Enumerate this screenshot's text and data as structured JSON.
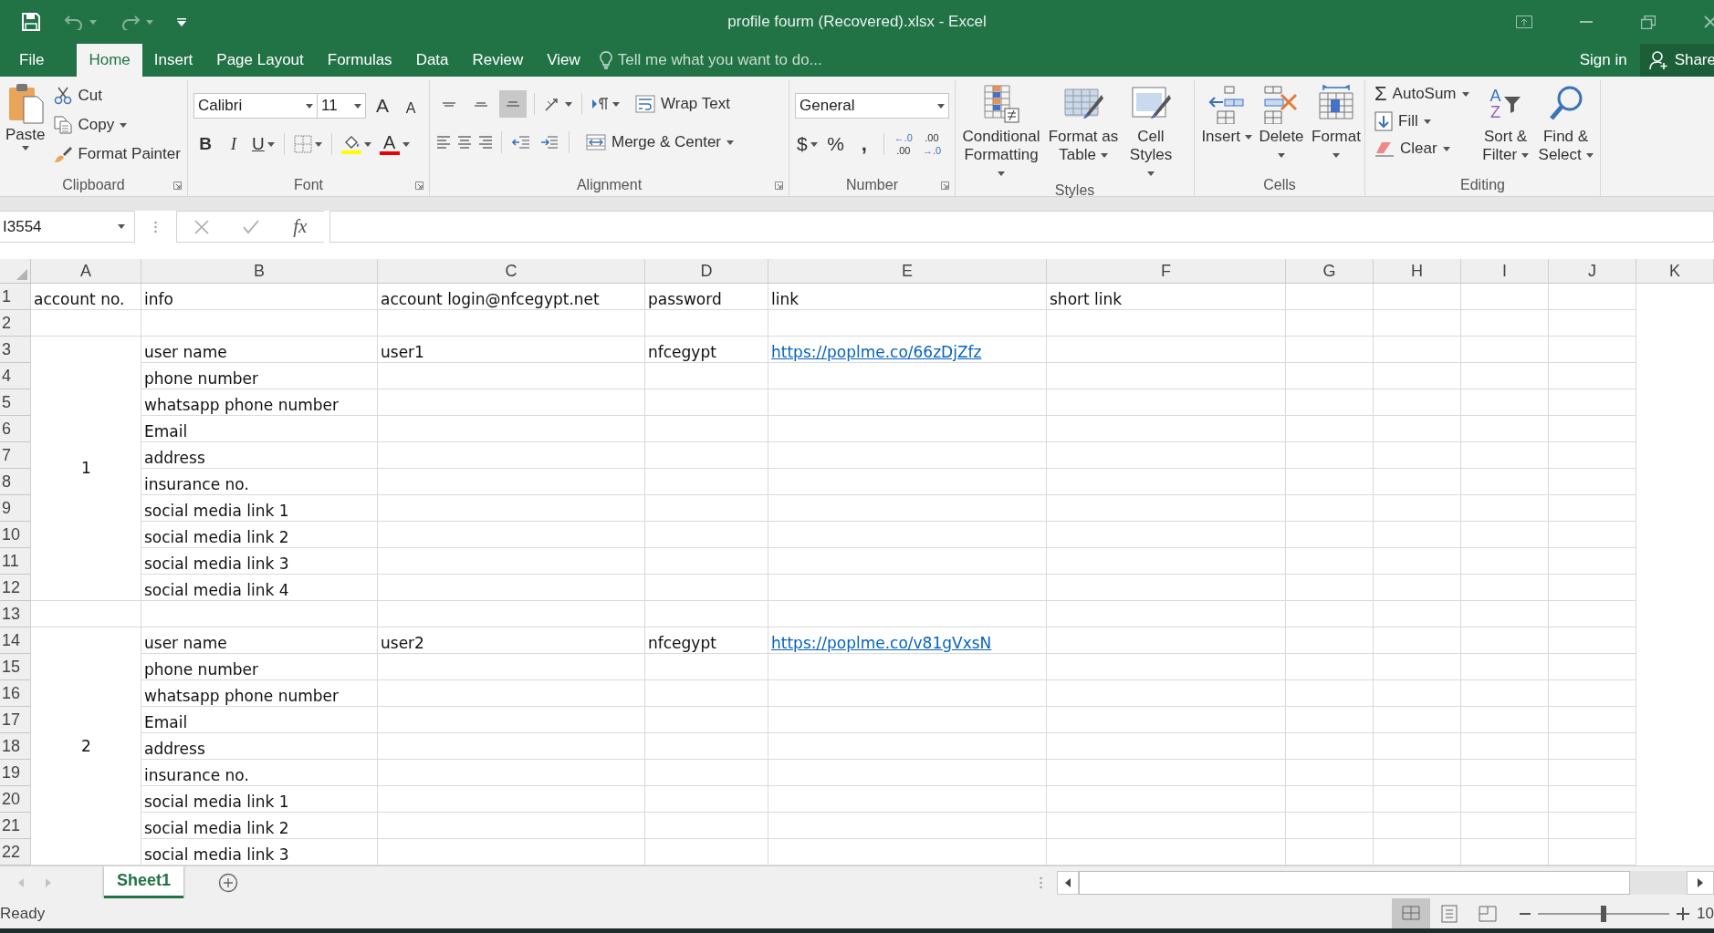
{
  "window": {
    "title": "profile fourm (Recovered).xlsx - Excel",
    "quick_access": [
      {
        "kind": "save",
        "disabled": false
      },
      {
        "kind": "undo",
        "disabled": true
      },
      {
        "kind": "redo",
        "disabled": true
      },
      {
        "kind": "customize",
        "disabled": false
      }
    ]
  },
  "tabs": [
    {
      "label": "File",
      "selected": false
    },
    {
      "label": "Home",
      "selected": true
    },
    {
      "label": "Insert",
      "selected": false
    },
    {
      "label": "Page Layout",
      "selected": false
    },
    {
      "label": "Formulas",
      "selected": false
    },
    {
      "label": "Data",
      "selected": false
    },
    {
      "label": "Review",
      "selected": false
    },
    {
      "label": "View",
      "selected": false
    }
  ],
  "tell_me": {
    "placeholder": "Tell me what you want to do..."
  },
  "account": {
    "sign_in": "Sign in",
    "share": "Share"
  },
  "ribbon": {
    "clipboard": {
      "label": "Clipboard",
      "paste": "Paste",
      "cut": "Cut",
      "copy": "Copy",
      "format_painter": "Format Painter"
    },
    "font": {
      "label": "Font",
      "font_name": "Calibri",
      "font_size": "11",
      "grow_font": "A",
      "shrink_font": "A",
      "bold": "B",
      "italic": "I",
      "underline": "U",
      "font_color": "A"
    },
    "alignment": {
      "label": "Alignment",
      "wrap_text": "Wrap Text",
      "merge_center": "Merge & Center",
      "vertical_align": [
        {
          "kind": "top",
          "selected": false
        },
        {
          "kind": "middle",
          "selected": false
        },
        {
          "kind": "bottom",
          "selected": true
        }
      ]
    },
    "number": {
      "label": "Number",
      "format": "General",
      "accounting": "$",
      "percent": "%",
      "comma": ",",
      "decimals": [
        {
          "kind": "increase",
          "top": "←.0",
          "bottom": ".00"
        },
        {
          "kind": "decrease",
          "top": ".00",
          "bottom": "→.0"
        }
      ]
    },
    "styles": {
      "label": "Styles",
      "buttons": [
        {
          "kind": "conditional",
          "label": "Conditional Formatting"
        },
        {
          "kind": "table",
          "label": "Format as Table"
        },
        {
          "kind": "cell_styles",
          "label": "Cell Styles"
        }
      ]
    },
    "cells": {
      "label": "Cells",
      "buttons": [
        {
          "kind": "insert",
          "label": "Insert"
        },
        {
          "kind": "delete",
          "label": "Delete"
        },
        {
          "kind": "format",
          "label": "Format"
        }
      ]
    },
    "editing": {
      "label": "Editing",
      "autosum_symbol": "Σ",
      "autosum": "AutoSum",
      "fill": "Fill",
      "clear": "Clear",
      "sort_letters": [
        "A",
        "Z"
      ],
      "sort_filter": "Sort & Filter",
      "find_select": "Find & Select"
    }
  },
  "formula_bar": {
    "name_box": "I3554",
    "function_symbol": "fx"
  },
  "sheet": {
    "columns": [
      "A",
      "B",
      "C",
      "D",
      "E",
      "F",
      "G",
      "H",
      "I",
      "J",
      "K"
    ],
    "row_numbers": [
      "1",
      "2",
      "3",
      "4",
      "5",
      "6",
      "7",
      "8",
      "9",
      "10",
      "11",
      "12",
      "13",
      "14",
      "15",
      "16",
      "17",
      "18",
      "19",
      "20",
      "21",
      "22"
    ],
    "header": [
      "account no.",
      "info",
      "account login@nfcegypt.net",
      "password",
      "link",
      "short link"
    ],
    "accounts": [
      {
        "number": "1",
        "rows": [
          {
            "info": "user name",
            "login": "user1",
            "password": "nfcegypt",
            "link": "https://poplme.co/66zDjZfz"
          },
          {
            "info": "phone number"
          },
          {
            "info": "whatsapp phone number"
          },
          {
            "info": "Email"
          },
          {
            "info": "address"
          },
          {
            "info": "insurance no."
          },
          {
            "info": "social media link 1"
          },
          {
            "info": "social media link 2"
          },
          {
            "info": "social media link 3"
          },
          {
            "info": "social media link 4"
          }
        ]
      },
      {
        "number": "2",
        "rows": [
          {
            "info": "user name",
            "login": "user2",
            "password": "nfcegypt",
            "link": "https://poplme.co/v81gVxsN"
          },
          {
            "info": "phone number"
          },
          {
            "info": "whatsapp phone number"
          },
          {
            "info": "Email"
          },
          {
            "info": "address"
          },
          {
            "info": "insurance no."
          },
          {
            "info": "social media link 1"
          },
          {
            "info": "social media link 2"
          },
          {
            "info": "social media link 3"
          }
        ]
      }
    ]
  },
  "sheet_tabs": [
    {
      "label": "Sheet1",
      "selected": true
    }
  ],
  "status_bar": {
    "status": "Ready",
    "views": [
      {
        "kind": "normal",
        "selected": true
      },
      {
        "kind": "page_layout",
        "selected": false
      },
      {
        "kind": "page_break",
        "selected": false
      }
    ],
    "zoom": {
      "level": 0.5,
      "reading": "10"
    }
  }
}
